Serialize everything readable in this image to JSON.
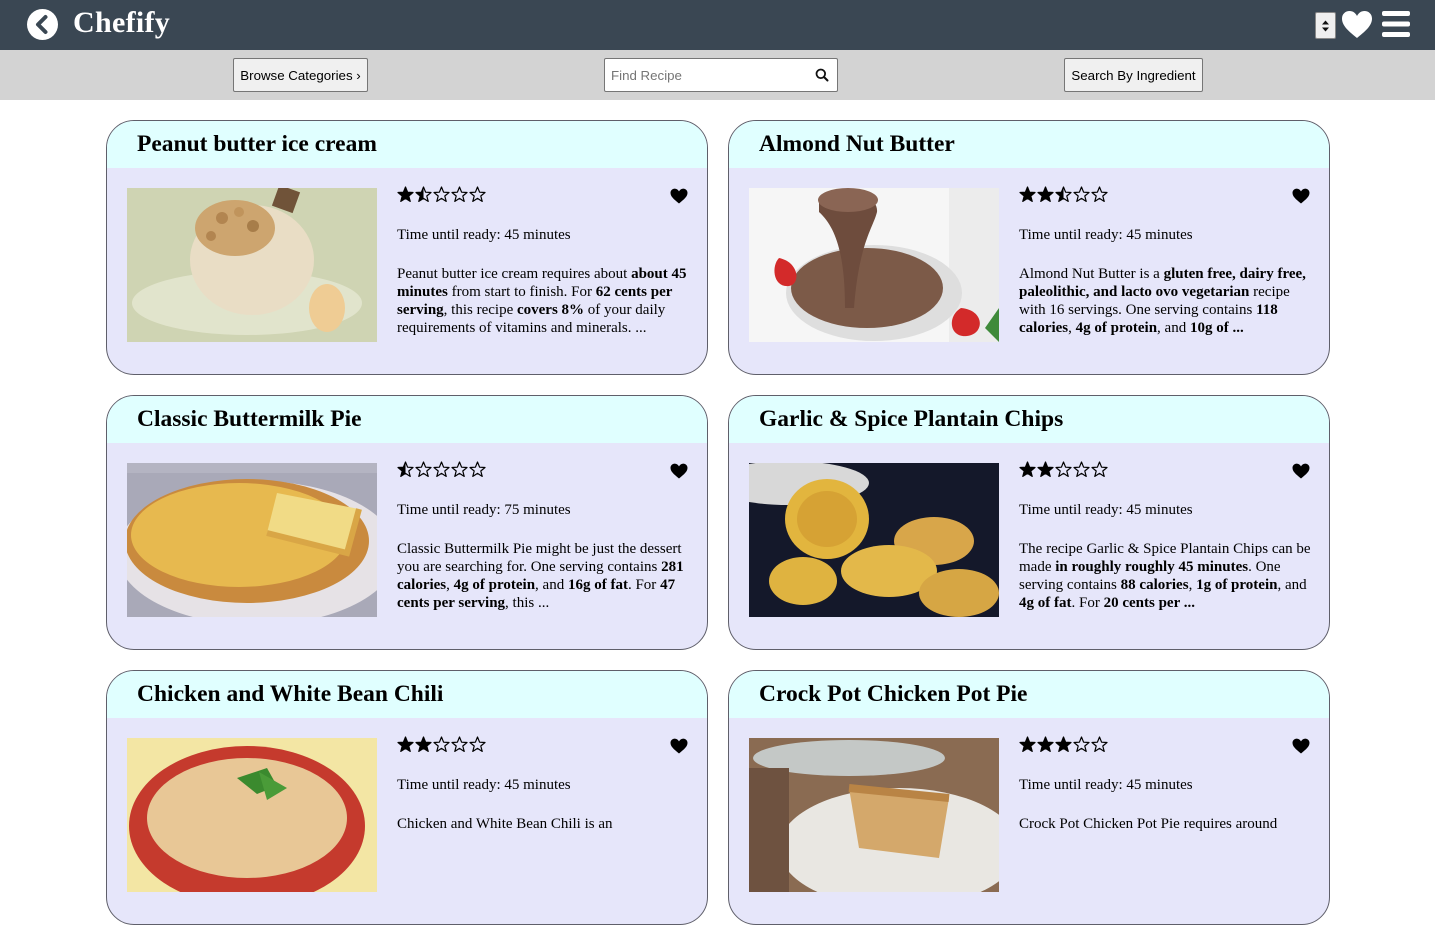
{
  "app": {
    "title": "Chefify"
  },
  "toolbar": {
    "browse_label": "Browse Categories ›",
    "search_placeholder": "Find Recipe",
    "ingredient_label": "Search By Ingredient"
  },
  "icons": {
    "back": "chevron-left-circle-icon",
    "sort": "sort-select-icon",
    "favorites": "heart-icon",
    "menu": "hamburger-menu-icon",
    "search": "magnifier-icon"
  },
  "colors": {
    "topbar": "#3a4753",
    "subbar": "#d3d3d3",
    "card_head": "#e0ffff",
    "card_body": "#e6e6fa"
  },
  "recipes": [
    {
      "title": "Peanut butter ice cream",
      "rating": 1.5,
      "ready": "Time until ready: 45 minutes",
      "summary": [
        {
          "t": "Peanut butter ice cream requires about "
        },
        {
          "t": "about 45 minutes",
          "b": true
        },
        {
          "t": " from start to finish. For "
        },
        {
          "t": "62 cents per serving",
          "b": true
        },
        {
          "t": ", this recipe "
        },
        {
          "t": "covers 8%",
          "b": true
        },
        {
          "t": " of your daily requirements of vitamins and minerals. ..."
        }
      ]
    },
    {
      "title": "Almond Nut Butter",
      "rating": 2.5,
      "ready": "Time until ready: 45 minutes",
      "summary": [
        {
          "t": "Almond Nut Butter is a "
        },
        {
          "t": "gluten free, dairy free, paleolithic, and lacto ovo vegetarian",
          "b": true
        },
        {
          "t": " recipe with 16 servings. One serving contains "
        },
        {
          "t": "118 calories",
          "b": true
        },
        {
          "t": ", "
        },
        {
          "t": "4g of protein",
          "b": true
        },
        {
          "t": ", and "
        },
        {
          "t": "10g of ...",
          "b": true
        }
      ]
    },
    {
      "title": "Classic Buttermilk Pie",
      "rating": 0.5,
      "ready": "Time until ready: 75 minutes",
      "summary": [
        {
          "t": "Classic Buttermilk Pie might be just the dessert you are searching for. One serving contains "
        },
        {
          "t": "281 calories",
          "b": true
        },
        {
          "t": ", "
        },
        {
          "t": "4g of protein",
          "b": true
        },
        {
          "t": ", and "
        },
        {
          "t": "16g of fat",
          "b": true
        },
        {
          "t": ". For "
        },
        {
          "t": "47 cents per serving",
          "b": true
        },
        {
          "t": ", this ..."
        }
      ]
    },
    {
      "title": "Garlic & Spice Plantain Chips",
      "rating": 2,
      "ready": "Time until ready: 45 minutes",
      "summary": [
        {
          "t": "The recipe Garlic & Spice Plantain Chips can be made "
        },
        {
          "t": "in roughly roughly 45 minutes",
          "b": true
        },
        {
          "t": ". One serving contains "
        },
        {
          "t": "88 calories",
          "b": true
        },
        {
          "t": ", "
        },
        {
          "t": "1g of protein",
          "b": true
        },
        {
          "t": ", and "
        },
        {
          "t": "4g of fat",
          "b": true
        },
        {
          "t": ". For "
        },
        {
          "t": "20 cents per ...",
          "b": true
        }
      ]
    },
    {
      "title": "Chicken and White Bean Chili",
      "rating": 2,
      "ready": "Time until ready: 45 minutes",
      "summary": [
        {
          "t": "Chicken and White Bean Chili is an"
        }
      ]
    },
    {
      "title": "Crock Pot Chicken Pot Pie",
      "rating": 3,
      "ready": "Time until ready: 45 minutes",
      "summary": [
        {
          "t": "Crock Pot Chicken Pot Pie requires around"
        }
      ]
    }
  ]
}
